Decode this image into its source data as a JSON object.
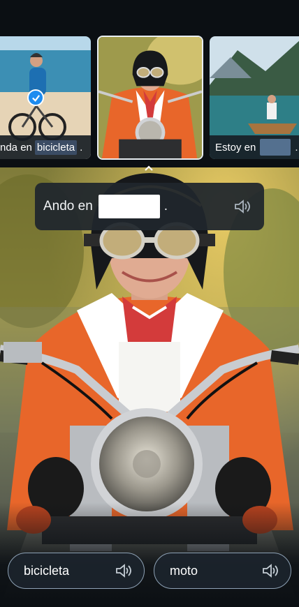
{
  "carousel": [
    {
      "caption_prefix": "nda en",
      "caption_word": "bicicleta",
      "caption_suffix": ".",
      "selected": true
    },
    {
      "caption_prefix": "",
      "caption_word": "",
      "caption_suffix": "",
      "selected": false,
      "active": true
    },
    {
      "caption_prefix": "Estoy en",
      "caption_word": "",
      "caption_suffix": ".",
      "selected": false
    }
  ],
  "prompt": {
    "text_before": "Ando en",
    "text_after": "."
  },
  "options": [
    {
      "label": "bicicleta"
    },
    {
      "label": "moto"
    }
  ],
  "icons": {
    "speaker": "speaker-icon",
    "check": "check-icon",
    "chevron": "chevron-up-icon"
  },
  "colors": {
    "accent": "#1d8cf0",
    "jacket": "#e8662a",
    "bubble": "#20262d"
  }
}
